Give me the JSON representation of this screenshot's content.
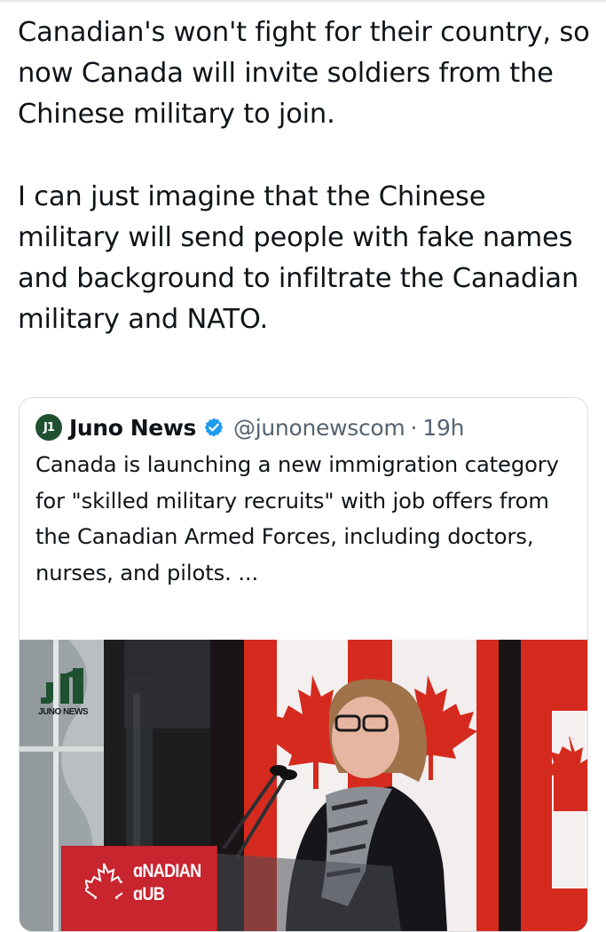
{
  "post": {
    "paragraph1": "Canadian's won't fight for their country, so now Canada will invite soldiers from the Chinese military to join.",
    "paragraph2": "I can just imagine that the Chinese military will send people with fake names and background to infiltrate the Canadian military and NATO."
  },
  "quoted": {
    "avatar_text": "J1",
    "display_name": "Juno News",
    "verified_icon": "verified-badge-icon",
    "handle": "@junonewscom",
    "separator": "·",
    "time": "19h",
    "text": "Canada is launching a new immigration category for \"skilled military recruits\" with job offers from the Canadian Armed Forces, including doctors, nurses, and pilots. ...",
    "media": {
      "watermark_text": "JUNO NEWS",
      "podium_line1": "ɑNADIAN",
      "podium_line2": "ɑUB"
    }
  },
  "colors": {
    "text": "#0f1419",
    "secondary": "#536471",
    "verified": "#1d9bf0",
    "card_border": "#d6dde2",
    "flag_red": "#d52b1e",
    "brand_green": "#1f5130"
  }
}
